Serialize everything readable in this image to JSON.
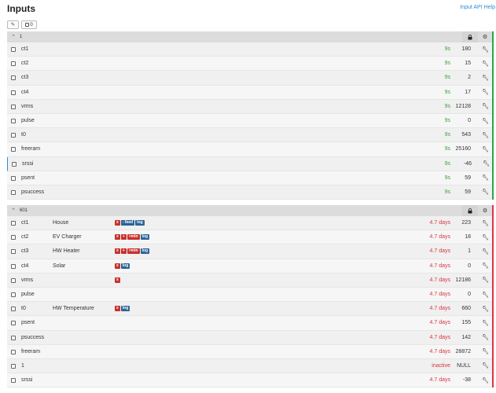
{
  "header": {
    "title": "Inputs",
    "help": "Input API Help"
  },
  "toolbar": {
    "edit_icon": "pencil-icon",
    "select_icon": "checkbox-icon",
    "select_count": "0"
  },
  "colors": {
    "green": "#3ca33c",
    "red": "#d9363e",
    "badge_red": "#c9302c",
    "badge_blue": "#2a6496",
    "status_green": "#28a745",
    "status_red": "#dc3545"
  },
  "groups": [
    {
      "name": "1",
      "status": "green",
      "rows": [
        {
          "name": "ct1",
          "desc": "",
          "processes": [],
          "time": "9s",
          "value": "180"
        },
        {
          "name": "ct2",
          "desc": "",
          "processes": [],
          "time": "9s",
          "value": "15"
        },
        {
          "name": "ct3",
          "desc": "",
          "processes": [],
          "time": "9s",
          "value": "2"
        },
        {
          "name": "ct4",
          "desc": "",
          "processes": [],
          "time": "9s",
          "value": "17"
        },
        {
          "name": "vrms",
          "desc": "",
          "processes": [],
          "time": "9s",
          "value": "12128"
        },
        {
          "name": "pulse",
          "desc": "",
          "processes": [],
          "time": "9s",
          "value": "0"
        },
        {
          "name": "t0",
          "desc": "",
          "processes": [],
          "time": "9s",
          "value": "543"
        },
        {
          "name": "freeram",
          "desc": "",
          "processes": [],
          "time": "9s",
          "value": "25160"
        },
        {
          "name": "srssi",
          "desc": "",
          "processes": [],
          "time": "9s",
          "value": "-46"
        },
        {
          "name": "psent",
          "desc": "",
          "processes": [],
          "time": "9s",
          "value": "59"
        },
        {
          "name": "psuccess",
          "desc": "",
          "processes": [],
          "time": "9s",
          "value": "59"
        }
      ]
    },
    {
      "name": "601",
      "status": "red",
      "rows": [
        {
          "name": "ct1",
          "desc": "House",
          "processes": [
            {
              "t": "x",
              "c": "red"
            },
            {
              "t": "- feed",
              "c": "blue"
            },
            {
              "t": "log",
              "c": "blue"
            }
          ],
          "time": "4.7 days",
          "value": "223"
        },
        {
          "name": "ct2",
          "desc": "EV Charger",
          "processes": [
            {
              "t": "x",
              "c": "red"
            },
            {
              "t": "+",
              "c": "red"
            },
            {
              "t": ">min",
              "c": "red"
            },
            {
              "t": "log",
              "c": "blue"
            }
          ],
          "time": "4.7 days",
          "value": "18"
        },
        {
          "name": "ct3",
          "desc": "HW Heater",
          "processes": [
            {
              "t": "x",
              "c": "red"
            },
            {
              "t": "+",
              "c": "red"
            },
            {
              "t": ">min",
              "c": "red"
            },
            {
              "t": "log",
              "c": "blue"
            }
          ],
          "time": "4.7 days",
          "value": "1"
        },
        {
          "name": "ct4",
          "desc": "Solar",
          "processes": [
            {
              "t": "x",
              "c": "red"
            },
            {
              "t": "log",
              "c": "blue"
            }
          ],
          "time": "4.7 days",
          "value": "0"
        },
        {
          "name": "vrms",
          "desc": "",
          "processes": [
            {
              "t": "x",
              "c": "red"
            }
          ],
          "time": "4.7 days",
          "value": "12186"
        },
        {
          "name": "pulse",
          "desc": "",
          "processes": [],
          "time": "4.7 days",
          "value": "0"
        },
        {
          "name": "t0",
          "desc": "HW Temperature",
          "processes": [
            {
              "t": "x",
              "c": "red"
            },
            {
              "t": "log",
              "c": "blue"
            }
          ],
          "time": "4.7 days",
          "value": "660"
        },
        {
          "name": "psent",
          "desc": "",
          "processes": [],
          "time": "4.7 days",
          "value": "155"
        },
        {
          "name": "psuccess",
          "desc": "",
          "processes": [],
          "time": "4.7 days",
          "value": "142"
        },
        {
          "name": "freeram",
          "desc": "",
          "processes": [],
          "time": "4.7 days",
          "value": "28872"
        },
        {
          "name": "1",
          "desc": "",
          "processes": [],
          "time": "inactive",
          "value": "NULL"
        },
        {
          "name": "srssi",
          "desc": "",
          "processes": [],
          "time": "4.7 days",
          "value": "-38"
        }
      ]
    }
  ]
}
